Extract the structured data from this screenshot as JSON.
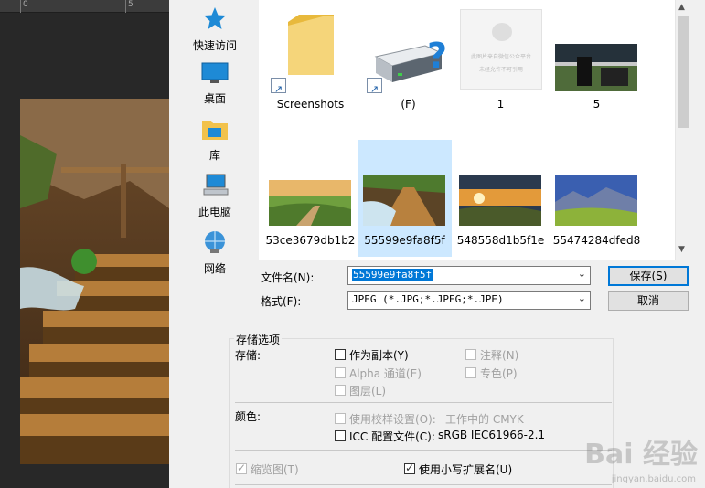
{
  "ruler": {
    "labels": [
      "0",
      "5"
    ]
  },
  "nav": [
    {
      "label": "快速访问",
      "icon": "star-icon"
    },
    {
      "label": "桌面",
      "icon": "desktop-icon"
    },
    {
      "label": "库",
      "icon": "library-icon"
    },
    {
      "label": "此电脑",
      "icon": "computer-icon"
    },
    {
      "label": "网络",
      "icon": "network-icon"
    }
  ],
  "files": [
    {
      "name": "Screenshots",
      "kind": "folder"
    },
    {
      "name": "(F)",
      "kind": "drive"
    },
    {
      "name": "1",
      "kind": "image",
      "thumb_text_1": "此图片来自微信公众平台",
      "thumb_text_2": "未经允许不可引用"
    },
    {
      "name": "5",
      "kind": "image"
    },
    {
      "name": "53ce3679db1b2",
      "kind": "image"
    },
    {
      "name": "55599e9fa8f5f",
      "kind": "image",
      "selected": true
    },
    {
      "name": "548558d1b5f1e",
      "kind": "image"
    },
    {
      "name": "55474284dfed8",
      "kind": "image"
    }
  ],
  "form": {
    "filename_label": "文件名(N):",
    "filename_value": "55599e9fa8f5f",
    "format_label": "格式(F):",
    "format_value": "JPEG (*.JPG;*.JPEG;*.JPE)",
    "save_button": "保存(S)",
    "cancel_button": "取消"
  },
  "options": {
    "group_title": "存储选项",
    "save_label": "存储:",
    "as_copy": "作为副本(Y)",
    "annotations": "注释(N)",
    "alpha": "Alpha 通道(E)",
    "spot": "专色(P)",
    "layers": "图层(L)",
    "color_label": "颜色:",
    "proof": "使用校样设置(O):",
    "proof_value": "工作中的 CMYK",
    "icc": "ICC 配置文件(C):",
    "icc_value": "sRGB IEC61966-2.1",
    "thumbnail": "缩览图(T)",
    "lowercase_ext": "使用小写扩展名(U)"
  },
  "watermark": {
    "main": "Bai 经验",
    "sub": "jingyan.baidu.com"
  },
  "colors": {
    "accent": "#0078d7",
    "selection": "#cce8ff",
    "folder": "#f5c842"
  }
}
